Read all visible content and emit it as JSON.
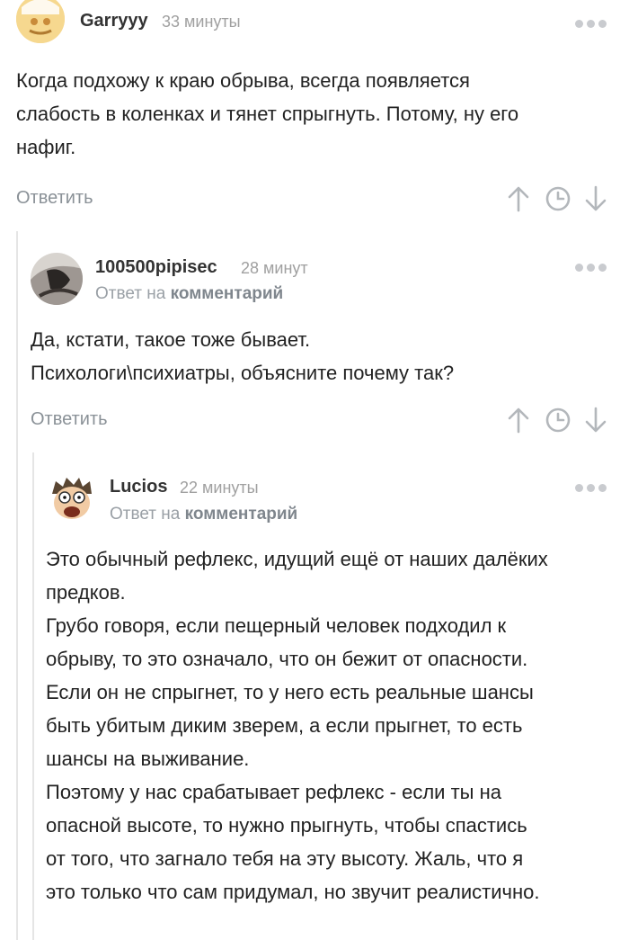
{
  "comments": [
    {
      "username": "Garryyy",
      "time": "33 минуты",
      "text": [
        "Когда подхожу к краю обрыва, всегда появляется",
        "слабость в коленках и тянет спрыгнуть. Потому, ну его",
        "нафиг."
      ],
      "reply_label": "Ответить",
      "avatar": "garryyy-avatar"
    },
    {
      "username": "100500pipisec",
      "time": "28 минут",
      "reply_to_prefix": "Ответ на",
      "reply_to_link": "комментарий",
      "text": [
        "Да, кстати, такое тоже бывает.",
        "Психологи\\психиатры, объясните почему так?"
      ],
      "reply_label": "Ответить",
      "avatar": "100500pipisec-avatar"
    },
    {
      "username": "Lucios",
      "time": "22 минуты",
      "reply_to_prefix": "Ответ на",
      "reply_to_link": "комментарий",
      "text": [
        "Это обычный рефлекс, идущий ещё от наших далёких",
        "предков.",
        "Грубо говоря, если пещерный человек подходил к",
        "обрыву, то это означало, что он бежит от опасности.",
        "Если он не спрыгнет, то у него есть реальные шансы",
        "быть убитым диким зверем, а если прыгнет, то есть",
        "шансы на выживание.",
        "Поэтому у нас срабатывает рефлекс - если ты на",
        "опасной высоте, то нужно прыгнуть, чтобы спастись",
        "от того, что загнало тебя на эту высоту. Жаль, что я",
        "это только что сам придумал, но звучит реалистично."
      ],
      "avatar": "lucios-avatar"
    }
  ],
  "icons": {
    "more": "more-dots-icon",
    "upvote": "arrow-up-icon",
    "save": "clock-icon",
    "downvote": "arrow-down-icon"
  },
  "colors": {
    "thread_line": "#e5e5e5",
    "muted": "#a0a0a0",
    "action": "#8a9197"
  }
}
